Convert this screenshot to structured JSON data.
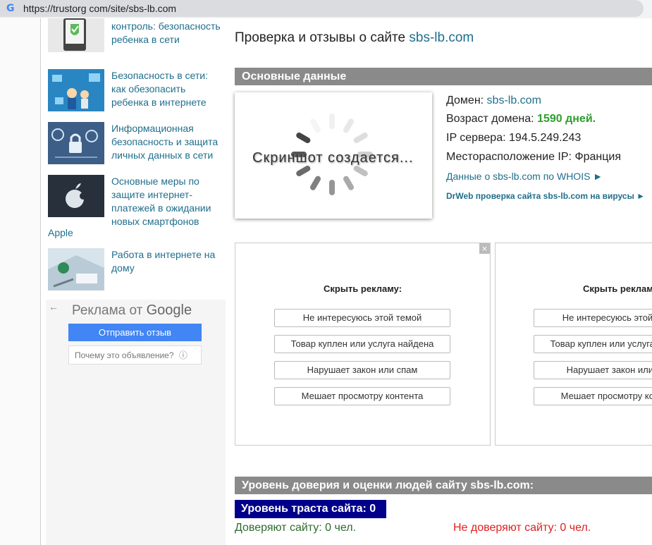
{
  "browser": {
    "url": "https://trustorg com/site/sbs-lb.com"
  },
  "sidebar": {
    "items": [
      {
        "label": "контроль: безопасность ребенка в сети"
      },
      {
        "label": "Безопасность в сети: как обезопасить ребенка в интернете"
      },
      {
        "label": "Информационная безопасность и защита личных данных в сети"
      },
      {
        "label": "Основные меры по защите интернет-платежей в ожидании новых смартфонов"
      },
      {
        "label": "Работа в интернете на дому"
      }
    ],
    "apple_tail": "Apple"
  },
  "google_ad": {
    "brand_prefix": "Реклама от",
    "brand_name": "Google",
    "send_feedback": "Отправить отзыв",
    "why_this_ad": "Почему это объявление?"
  },
  "main": {
    "title_prefix": "Проверка и отзывы о сайте",
    "title_domain": "sbs-lb.com",
    "section_main": "Основные данные",
    "screenshot_status": "Скриншот создается...",
    "domain_label": "Домен:",
    "domain_value": "sbs-lb.com",
    "age_label": "Возраст домена:",
    "age_value": "1590 дней.",
    "ip_label": "IP сервера:",
    "ip_value": "194.5.249.243",
    "location_label": "Месторасположение IP:",
    "location_value": "Франция",
    "whois_link": "Данные о sbs-lb.com по WHOIS ►",
    "drweb_link": "DrWeb проверка сайта sbs-lb.com на вирусы ►"
  },
  "ads": {
    "hide_title": "Скрыть рекламу:",
    "options": [
      "Не интересуюсь этой темой",
      "Товар куплен или услуга найдена",
      "Нарушает закон или спам",
      "Мешает просмотру контента"
    ]
  },
  "trust": {
    "section_title": "Уровень доверия и оценки людей сайту sbs-lb.com:",
    "badge": "Уровень траста сайта: 0",
    "trusted": "Доверяют сайту: 0 чел.",
    "not_trusted": "Не доверяют сайту: 0 чел."
  },
  "colors": {
    "link": "#1f6e8c",
    "section_bar": "#8a8a8a",
    "trust_badge": "#00008b",
    "age_green": "#2e9d2e",
    "not_trusted_red": "#e02020",
    "google_blue": "#4285f4"
  }
}
